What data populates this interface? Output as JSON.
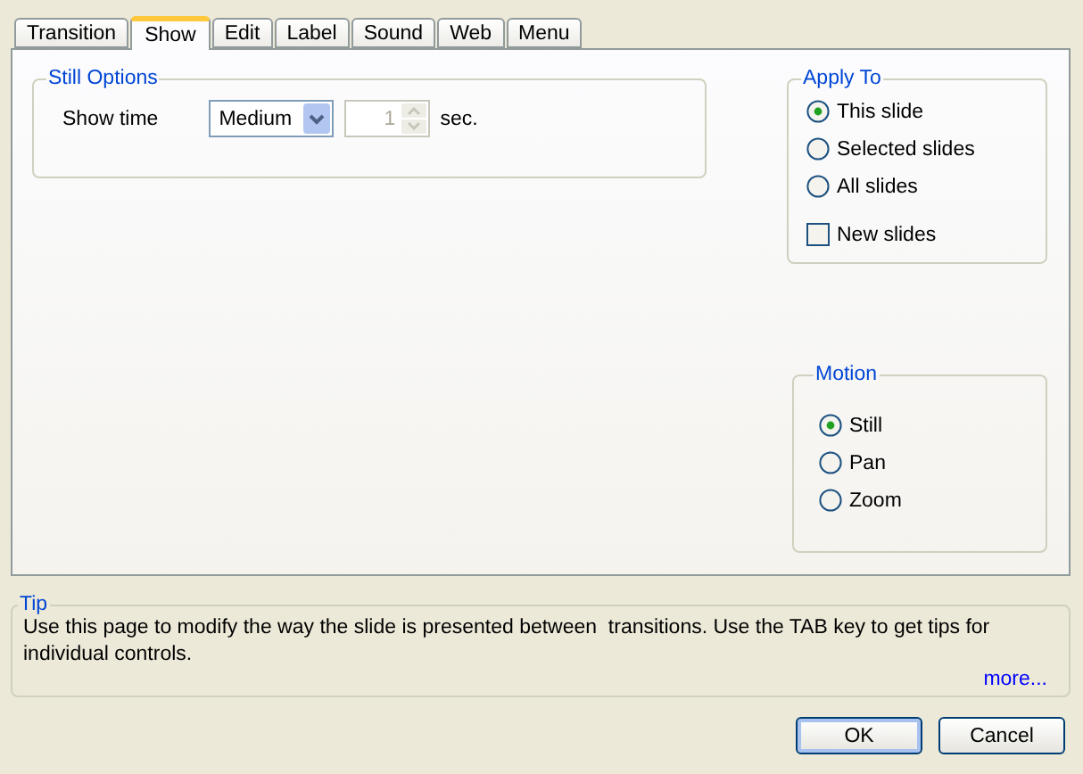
{
  "tabs": [
    {
      "label": "Transition",
      "selected": false
    },
    {
      "label": "Show",
      "selected": true
    },
    {
      "label": "Edit",
      "selected": false
    },
    {
      "label": "Label",
      "selected": false
    },
    {
      "label": "Sound",
      "selected": false
    },
    {
      "label": "Web",
      "selected": false
    },
    {
      "label": "Menu",
      "selected": false
    }
  ],
  "still_options": {
    "title": "Still Options",
    "show_time": {
      "label": "Show time",
      "value": "Medium",
      "count": {
        "value": "1",
        "disabled": true
      },
      "unit": "sec."
    }
  },
  "apply_to": {
    "title": "Apply To",
    "options": [
      {
        "label": "This slide",
        "selected": true
      },
      {
        "label": "Selected slides",
        "selected": false
      },
      {
        "label": "All slides",
        "selected": false
      }
    ],
    "new_slides": {
      "label": "New slides",
      "checked": false
    }
  },
  "motion": {
    "title": "Motion",
    "options": [
      {
        "label": "Still",
        "selected": true
      },
      {
        "label": "Pan",
        "selected": false
      },
      {
        "label": "Zoom",
        "selected": false
      }
    ]
  },
  "tip": {
    "title": "Tip",
    "text": "Use this page to modify the way the slide is presented between  transitions. Use the TAB key to get tips for individual controls.",
    "link": "more..."
  },
  "buttons": [
    {
      "label": "OK",
      "default": true
    },
    {
      "label": "Cancel",
      "default": false
    }
  ]
}
